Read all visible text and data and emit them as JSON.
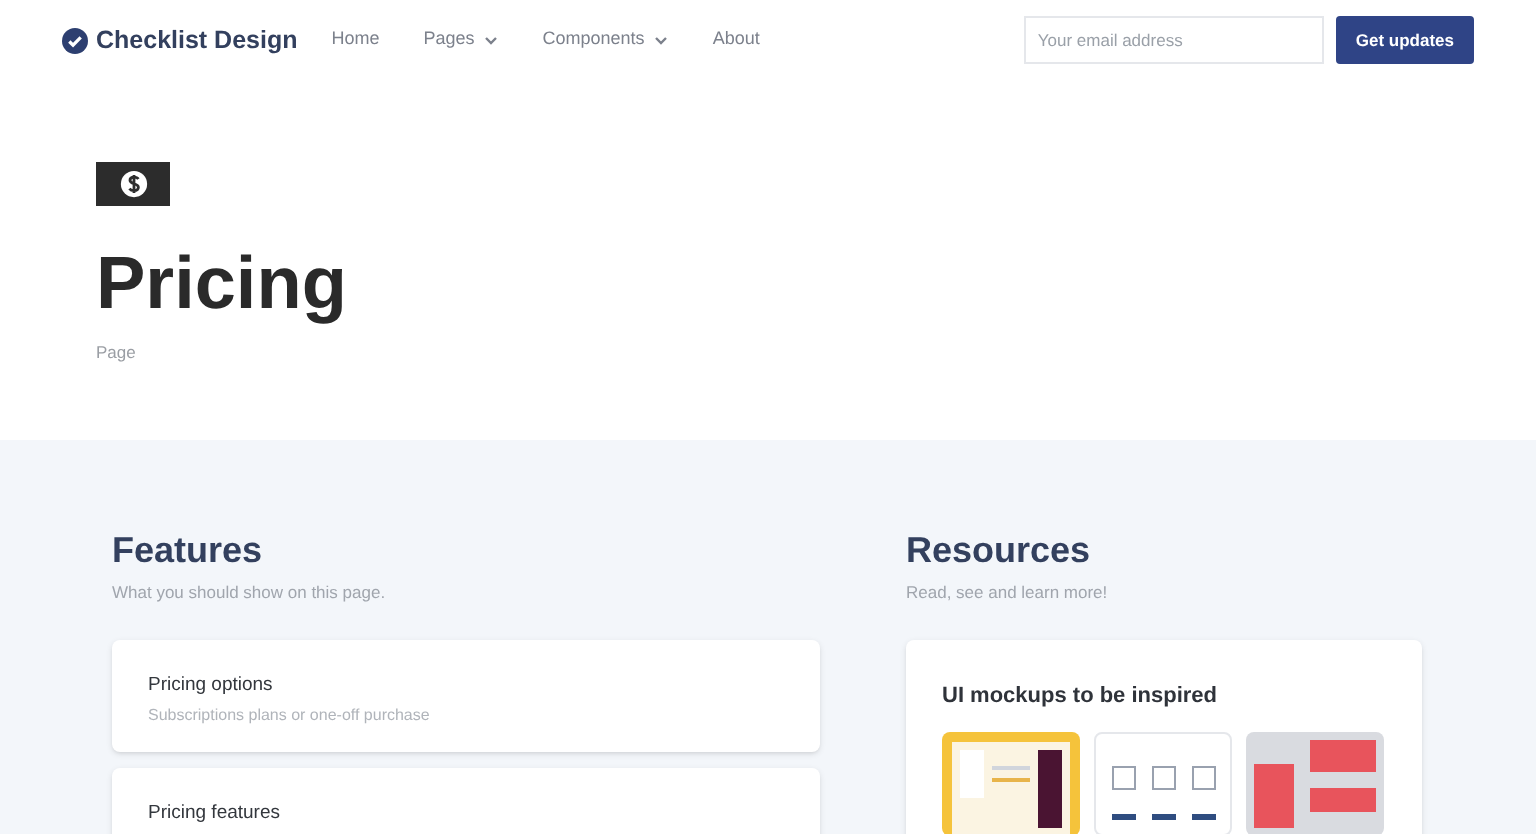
{
  "navbar": {
    "brand": "Checklist Design",
    "links": [
      {
        "label": "Home",
        "kind": "link"
      },
      {
        "label": "Pages",
        "kind": "dropdown"
      },
      {
        "label": "Components",
        "kind": "dropdown"
      },
      {
        "label": "About",
        "kind": "link"
      }
    ],
    "email_field": {
      "placeholder": "Your email address"
    },
    "button": "Get updates"
  },
  "hero": {
    "title": "Pricing",
    "subtitle": "Page"
  },
  "features": {
    "title": "Features",
    "subtitle": "What you should show on this page.",
    "cards": [
      {
        "title": "Pricing options",
        "description": "Subscriptions plans or one-off purchase"
      },
      {
        "title": "Pricing features"
      }
    ]
  },
  "resources": {
    "title": "Resources",
    "subtitle": "Read, see and learn more!",
    "card": {
      "title": "UI mockups to be inspired"
    }
  }
}
